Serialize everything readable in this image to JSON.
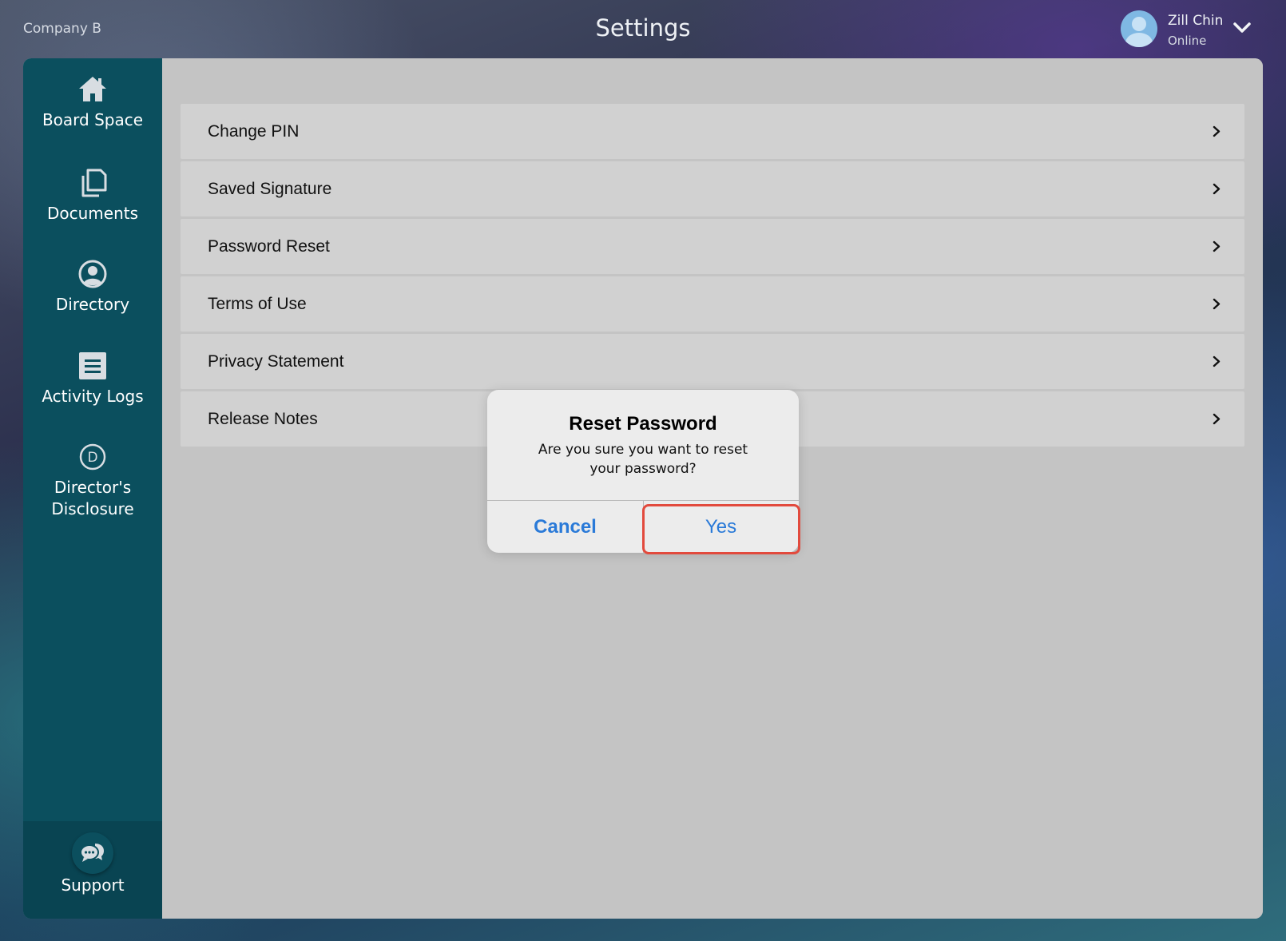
{
  "header": {
    "company": "Company B",
    "title": "Settings",
    "user": {
      "name": "Zill Chin",
      "status": "Online",
      "avatar_icon": "user-avatar-icon",
      "menu_icon": "chevron-down-icon"
    }
  },
  "sidebar": {
    "items": [
      {
        "label": "Board Space",
        "icon": "home-icon"
      },
      {
        "label": "Documents",
        "icon": "documents-icon"
      },
      {
        "label": "Directory",
        "icon": "user-circle-icon"
      },
      {
        "label": "Activity Logs",
        "icon": "list-icon"
      },
      {
        "label": "Director's\nDisclosure",
        "icon": "letter-d-circle-icon"
      }
    ],
    "support": {
      "label": "Support",
      "icon": "chat-bubbles-icon"
    }
  },
  "settings": {
    "rows": [
      {
        "label": "Change PIN"
      },
      {
        "label": "Saved Signature"
      },
      {
        "label": "Password Reset"
      },
      {
        "label": "Terms of Use"
      },
      {
        "label": "Privacy Statement"
      },
      {
        "label": "Release Notes"
      }
    ],
    "row_icon": "chevron-right-icon"
  },
  "dialog": {
    "title": "Reset Password",
    "message": "Are you sure you want to reset your password?",
    "cancel_label": "Cancel",
    "yes_label": "Yes"
  },
  "colors": {
    "sidebar": "#0b4f5e",
    "content": "#c4c4c4",
    "row": "#d1d1d1",
    "accent_blue": "#2a7ad8",
    "highlight": "#e24a3d"
  }
}
